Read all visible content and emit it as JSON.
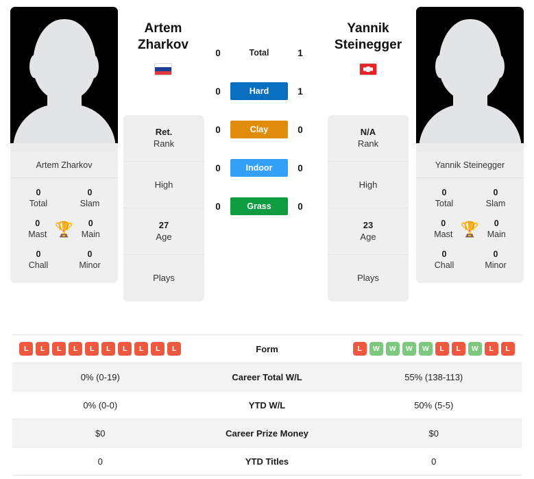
{
  "players": {
    "left": {
      "first_name": "Artem",
      "last_name": "Zharkov",
      "full_name": "Artem Zharkov",
      "flag": "russia-flag",
      "avatar": "player-avatar-placeholder",
      "rank_value": "Ret.",
      "rank_label": "Rank",
      "high_value": "",
      "high_label": "High",
      "age_value": "27",
      "age_label": "Age",
      "plays_value": "",
      "plays_label": "Plays",
      "titles": [
        {
          "value": "0",
          "label": "Total"
        },
        {
          "value": "0",
          "label": "Slam"
        },
        {
          "value": "0",
          "label": "Mast"
        },
        {
          "value": "0",
          "label": "Main"
        },
        {
          "value": "0",
          "label": "Chall"
        },
        {
          "value": "0",
          "label": "Minor"
        }
      ],
      "form": [
        "L",
        "L",
        "L",
        "L",
        "L",
        "L",
        "L",
        "L",
        "L",
        "L"
      ],
      "career_total_wl": "0% (0-19)",
      "ytd_wl": "0% (0-0)",
      "career_prize_money": "$0",
      "ytd_titles": "0"
    },
    "right": {
      "first_name": "Yannik",
      "last_name": "Steinegger",
      "full_name": "Yannik Steinegger",
      "flag": "switzerland-flag",
      "avatar": "player-avatar-placeholder",
      "rank_value": "N/A",
      "rank_label": "Rank",
      "high_value": "",
      "high_label": "High",
      "age_value": "23",
      "age_label": "Age",
      "plays_value": "",
      "plays_label": "Plays",
      "titles": [
        {
          "value": "0",
          "label": "Total"
        },
        {
          "value": "0",
          "label": "Slam"
        },
        {
          "value": "0",
          "label": "Mast"
        },
        {
          "value": "0",
          "label": "Main"
        },
        {
          "value": "0",
          "label": "Chall"
        },
        {
          "value": "0",
          "label": "Minor"
        }
      ],
      "form": [
        "L",
        "W",
        "W",
        "W",
        "W",
        "L",
        "L",
        "W",
        "L",
        "L"
      ],
      "career_total_wl": "55% (138-113)",
      "ytd_wl": "50% (5-5)",
      "career_prize_money": "$0",
      "ytd_titles": "0"
    }
  },
  "h2h": [
    {
      "surface": "Total",
      "left": "0",
      "right": "1",
      "color": "none",
      "style": "plain"
    },
    {
      "surface": "Hard",
      "left": "0",
      "right": "1",
      "color": "#0b6fc0",
      "style": "badge"
    },
    {
      "surface": "Clay",
      "left": "0",
      "right": "0",
      "color": "#e08c0c",
      "style": "badge"
    },
    {
      "surface": "Indoor",
      "left": "0",
      "right": "0",
      "color": "#34a0f5",
      "style": "badge"
    },
    {
      "surface": "Grass",
      "left": "0",
      "right": "0",
      "color": "#0f9b3f",
      "style": "badge"
    }
  ],
  "stats_rows": [
    {
      "label": "Form",
      "type": "form"
    },
    {
      "label": "Career Total W/L",
      "type": "text",
      "key": "career_total_wl"
    },
    {
      "label": "YTD W/L",
      "type": "text",
      "key": "ytd_wl"
    },
    {
      "label": "Career Prize Money",
      "type": "text",
      "key": "career_prize_money"
    },
    {
      "label": "YTD Titles",
      "type": "text",
      "key": "ytd_titles"
    }
  ],
  "colors": {
    "hard": "#0b6fc0",
    "clay": "#e08c0c",
    "indoor": "#34a0f5",
    "grass": "#0f9b3f",
    "win_badge": "#7dc87f",
    "loss_badge": "#f0573f",
    "card_bg": "#efefef",
    "trophy": "#4a7ebb"
  },
  "icons": {
    "trophy": "trophy-icon",
    "flag_left": "russia-flag-icon",
    "flag_right": "switzerland-flag-icon"
  }
}
